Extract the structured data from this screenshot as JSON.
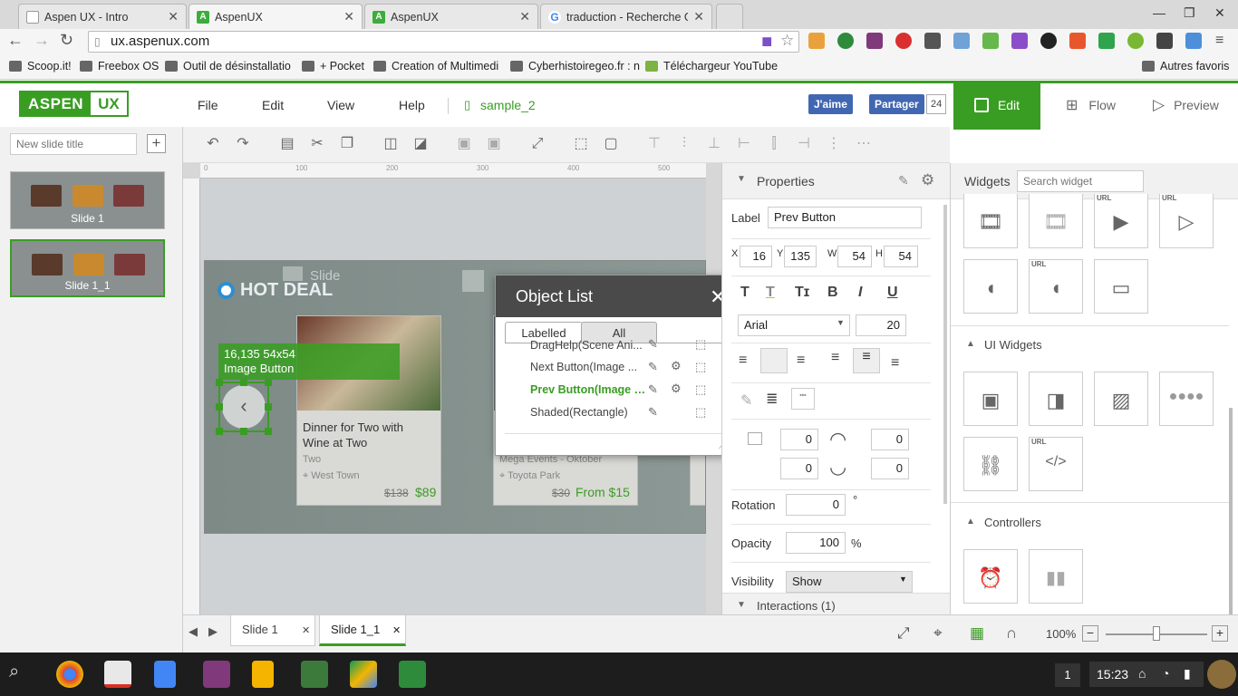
{
  "browser": {
    "tabs": [
      {
        "title": "Aspen UX - Intro"
      },
      {
        "title": "AspenUX"
      },
      {
        "title": "AspenUX"
      },
      {
        "title": "traduction - Recherche Go"
      }
    ],
    "url": "ux.aspenux.com",
    "bookmarks": [
      "Scoop.it!",
      "Freebox OS",
      "Outil de désinstallatio",
      "+ Pocket",
      "Creation of Multimedi",
      "Cyberhistoiregeo.fr : n",
      "Téléchargeur YouTube"
    ],
    "other_bookmarks": "Autres favoris"
  },
  "app": {
    "logo_a": "ASPEN",
    "logo_b": "UX",
    "menu": [
      "File",
      "Edit",
      "View",
      "Help"
    ],
    "file_name": "sample_2",
    "fb_like": "J'aime",
    "fb_share": "Partager",
    "fb_count": "24",
    "modes": {
      "edit": "Edit",
      "flow": "Flow",
      "preview": "Preview"
    }
  },
  "slides_panel": {
    "new_slide_placeholder": "New slide title",
    "slides": [
      {
        "label": "Slide 1"
      },
      {
        "label": "Slide 1_1"
      }
    ]
  },
  "canvas": {
    "ruler_marks": [
      "0",
      "100",
      "200",
      "300",
      "400",
      "500"
    ],
    "slide_watermark": "Slide",
    "hot_deal": "HOT DEAL",
    "selection_info_line1": "16,135  54x54",
    "selection_info_line2": "Image Button",
    "cards": [
      {
        "title": "Dinner for Two with Wine at Two",
        "sub": "Two",
        "location": "West Town",
        "old_price": "$138",
        "price": "$89"
      },
      {
        "title": "Mega Events - Oktober",
        "sub": "",
        "location": "Toyota Park",
        "old_price": "$30",
        "price": "From $15"
      }
    ]
  },
  "object_list": {
    "title": "Object List",
    "tabs": [
      "Labelled",
      "All"
    ],
    "items": [
      {
        "label": "DragHelp(Scene Ani..."
      },
      {
        "label": "Next Button(Image ..."
      },
      {
        "label": "Prev Button(Image B..."
      },
      {
        "label": "Shaded(Rectangle)"
      }
    ]
  },
  "bottom": {
    "slide_tabs": [
      "Slide 1",
      "Slide 1_1"
    ],
    "zoom": "100%",
    "zoom_level": 0.5
  },
  "properties": {
    "title": "Properties",
    "label_caption": "Label",
    "label_value": "Prev Button",
    "x_lbl": "X",
    "y_lbl": "Y",
    "w_lbl": "W",
    "h_lbl": "H",
    "x": "16",
    "y": "135",
    "w": "54",
    "h": "54",
    "font": "Arial",
    "font_size": "20",
    "border_vals": [
      "0",
      "0",
      "0",
      "0"
    ],
    "rotation_lbl": "Rotation",
    "rotation": "0",
    "rotation_unit": "°",
    "opacity_lbl": "Opacity",
    "opacity": "100",
    "opacity_unit": "%",
    "visibility_lbl": "Visibility",
    "visibility": "Show",
    "interactions": "Interactions (1)"
  },
  "widgets": {
    "title": "Widgets",
    "search_placeholder": "Search widget",
    "url_tag": "URL",
    "ui_widgets": "UI Widgets",
    "controllers": "Controllers"
  },
  "taskbar": {
    "notification_count": "1",
    "time": "15:23"
  },
  "colors": {
    "accent": "#3a9d23",
    "facebook": "#4267b2",
    "taskbar": "#1d1d1d"
  }
}
